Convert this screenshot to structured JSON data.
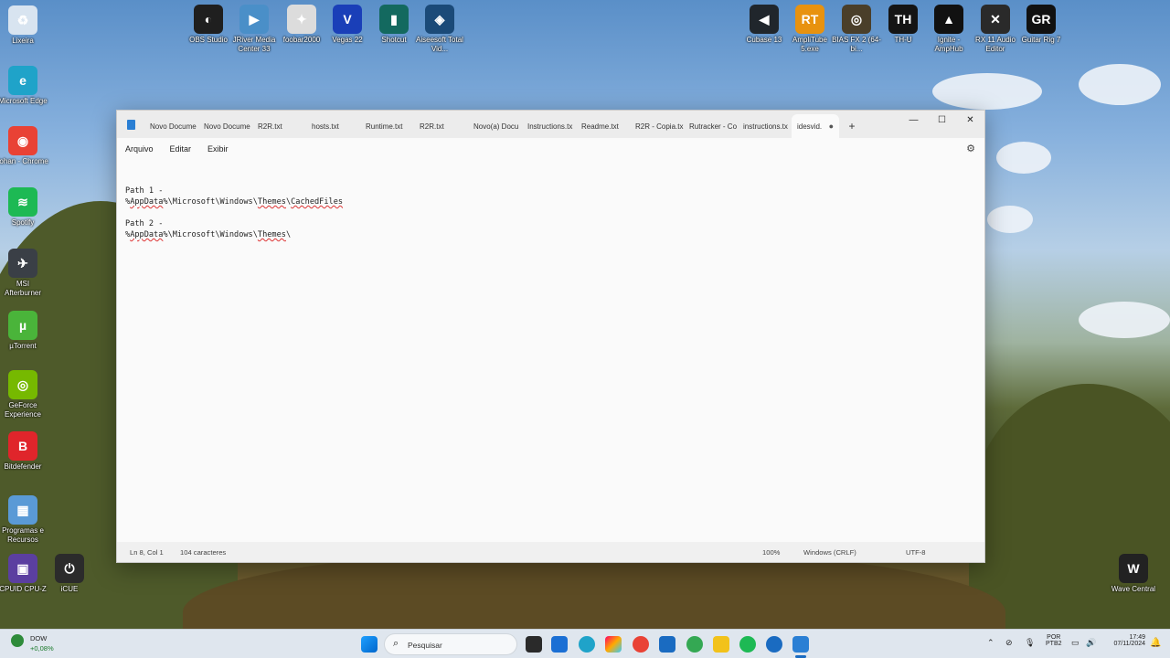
{
  "desktop": {
    "left_icons": [
      {
        "name": "recycle-bin-icon",
        "label": "Lixeira",
        "color": "#d8e4f0",
        "glyph": "♻"
      },
      {
        "name": "edge-icon",
        "label": "Microsoft Edge",
        "color": "#1fa3c9",
        "glyph": "e"
      },
      {
        "name": "chrome-icon",
        "label": "Iohan - Chrome",
        "color": "#e94235",
        "glyph": "◉"
      },
      {
        "name": "spotify-icon",
        "label": "Spotify",
        "color": "#1db954",
        "glyph": "≋"
      },
      {
        "name": "msi-afterburner-icon",
        "label": "MSI Afterburner",
        "color": "#3a3f46",
        "glyph": "✈"
      },
      {
        "name": "utorrent-icon",
        "label": "µTorrent",
        "color": "#4ab43a",
        "glyph": "µ"
      },
      {
        "name": "geforce-experience-icon",
        "label": "GeForce Experience",
        "color": "#76b900",
        "glyph": "◎"
      },
      {
        "name": "bitdefender-icon",
        "label": "Bitdefender",
        "color": "#e0252b",
        "glyph": "B"
      },
      {
        "name": "programas-icon",
        "label": "Programas e Recursos",
        "color": "#5a9ad6",
        "glyph": "▦"
      },
      {
        "name": "cpuz-icon",
        "label": "CPUID CPU-Z",
        "color": "#5b3fa0",
        "glyph": "▣"
      }
    ],
    "extra_icons": [
      {
        "name": "icue-icon",
        "label": "iCUE",
        "color": "#2b2b2b",
        "glyph": "⏻"
      }
    ],
    "top_icons": [
      {
        "name": "obs-icon",
        "label": "OBS Studio",
        "color": "#1f1f1f",
        "glyph": "◐"
      },
      {
        "name": "jriver-icon",
        "label": "JRiver Media Center 33",
        "color": "#4a8fc8",
        "glyph": "▶"
      },
      {
        "name": "foobar-icon",
        "label": "foobar2000",
        "color": "#dcdcdc",
        "glyph": "✦"
      },
      {
        "name": "vegas-icon",
        "label": "Vegas 22",
        "color": "#1a3fb8",
        "glyph": "V"
      },
      {
        "name": "shotcut-icon",
        "label": "Shotcut",
        "color": "#13695f",
        "glyph": "▮"
      },
      {
        "name": "aiseesoft-icon",
        "label": "Aiseesoft Total Vid...",
        "color": "#1b4a78",
        "glyph": "◈"
      }
    ],
    "top_right_icons": [
      {
        "name": "cubase-icon",
        "label": "Cubase 13",
        "color": "#20262c",
        "glyph": "◀"
      },
      {
        "name": "amplitube-icon",
        "label": "AmpliTube 5.exe",
        "color": "#e8920f",
        "glyph": "RT"
      },
      {
        "name": "biasfx-icon",
        "label": "BIAS FX 2 (64-bi...",
        "color": "#4a3f2a",
        "glyph": "◎"
      },
      {
        "name": "thu-icon",
        "label": "TH-U",
        "color": "#141414",
        "glyph": "TH"
      },
      {
        "name": "ignite-icon",
        "label": "Ignite - AmpHub",
        "color": "#111",
        "glyph": "▲"
      },
      {
        "name": "rx11-icon",
        "label": "RX 11 Audio Editor",
        "color": "#2a2a2a",
        "glyph": "✕"
      },
      {
        "name": "guitar-rig-icon",
        "label": "Guitar Rig 7",
        "color": "#111",
        "glyph": "GR"
      }
    ],
    "bottom_right_icon": {
      "name": "wave-central-icon",
      "label": "Wave Central",
      "color": "#222",
      "glyph": "W"
    }
  },
  "window": {
    "tabs": [
      "Novo Docume",
      "Novo Docume",
      "R2R.txt",
      "hosts.txt",
      "Runtime.txt",
      "R2R.txt",
      "Novo(a) Docu",
      "Instructions.tx",
      "Readme.txt",
      "R2R - Copia.tx",
      "Rutracker - Co",
      "instructions.tx"
    ],
    "active_tab": "idesvid.",
    "active_tab_dot": "●",
    "new_tab": "+",
    "controls": {
      "minimize": "—",
      "maximize": "☐",
      "close": "✕"
    },
    "menu": {
      "file": "Arquivo",
      "edit": "Editar",
      "view": "Exibir"
    },
    "settings_icon": "⚙",
    "lines": {
      "l1": "Path 1 -",
      "l2_a": "%",
      "l2_b": "AppData",
      "l2_c": "%\\Microsoft\\Windows\\",
      "l2_d": "Themes",
      "l2_e": "\\",
      "l2_f": "CachedFiles",
      "l3": "Path 2 -",
      "l4_a": "%",
      "l4_b": "AppData",
      "l4_c": "%\\Microsoft\\Windows\\",
      "l4_d": "Themes",
      "l4_e": "\\"
    },
    "status": {
      "position": "Ln 8, Col 1",
      "chars": "104 caracteres",
      "zoom": "100%",
      "eol": "Windows (CRLF)",
      "encoding": "UTF-8"
    }
  },
  "taskbar": {
    "weather_temp": "DOW",
    "weather_change": "+0,08%",
    "search_placeholder": "Pesquisar",
    "lang1": "POR",
    "lang2": "PTB2",
    "time": "17:49",
    "date": "07/11/2024"
  }
}
